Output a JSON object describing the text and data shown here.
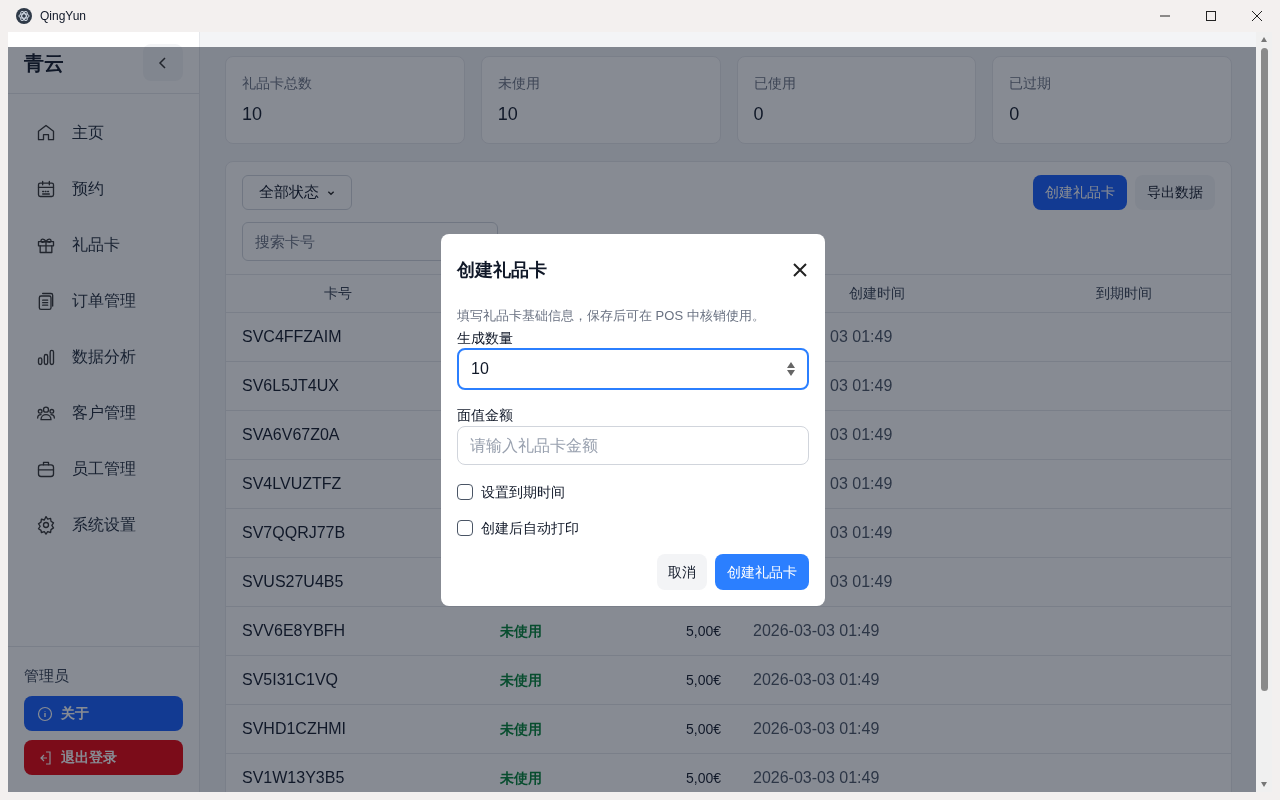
{
  "window": {
    "title": "QingYun"
  },
  "sidebar": {
    "logo": "青云",
    "items": [
      {
        "label": "主页"
      },
      {
        "label": "预约"
      },
      {
        "label": "礼品卡"
      },
      {
        "label": "订单管理"
      },
      {
        "label": "数据分析"
      },
      {
        "label": "客户管理"
      },
      {
        "label": "员工管理"
      },
      {
        "label": "系统设置"
      }
    ],
    "user": "管理员",
    "buttons": [
      {
        "label": "关于",
        "kind": "about"
      },
      {
        "label": "退出登录",
        "kind": "logout"
      }
    ]
  },
  "stats": [
    {
      "label": "礼品卡总数",
      "value": "10"
    },
    {
      "label": "未使用",
      "value": "10"
    },
    {
      "label": "已使用",
      "value": "0"
    },
    {
      "label": "已过期",
      "value": "0"
    }
  ],
  "filters": {
    "status_select": "全部状态",
    "search_placeholder": "搜索卡号"
  },
  "actions": [
    {
      "label": "创建礼品卡",
      "kind": "primary"
    },
    {
      "label": "导出数据",
      "kind": "secondary"
    }
  ],
  "table": {
    "columns": {
      "card_no": "卡号",
      "created": "创建时间",
      "expires": "到期时间"
    },
    "rows": [
      {
        "card_no": "SVC4FFZAIM",
        "created": "03 01:49"
      },
      {
        "card_no": "SV6L5JT4UX",
        "created": "03 01:49"
      },
      {
        "card_no": "SVA6V67Z0A",
        "created": "03 01:49"
      },
      {
        "card_no": "SV4LVUZTFZ",
        "created": "03 01:49"
      },
      {
        "card_no": "SV7QQRJ77B",
        "created": "03 01:49"
      },
      {
        "card_no": "SVUS27U4B5",
        "created": "03 01:49"
      },
      {
        "card_no": "SVV6E8YBFH",
        "status": "未使用",
        "amount": "5,00€",
        "created": "2026-03-03 01:49"
      },
      {
        "card_no": "SV5I31C1VQ",
        "status": "未使用",
        "amount": "5,00€",
        "created": "2026-03-03 01:49"
      },
      {
        "card_no": "SVHD1CZHMI",
        "status": "未使用",
        "amount": "5,00€",
        "created": "2026-03-03 01:49"
      },
      {
        "card_no": "SV1W13Y3B5",
        "status": "未使用",
        "amount": "5,00€",
        "created": "2026-03-03 01:49"
      }
    ]
  },
  "dialog": {
    "title": "创建礼品卡",
    "description": "填写礼品卡基础信息，保存后可在 POS 中核销使用。",
    "fields": [
      {
        "label": "生成数量",
        "value": "10",
        "kind": "number",
        "focused": true
      },
      {
        "label": "面值金额",
        "placeholder": "请输入礼品卡金额",
        "kind": "text",
        "focused": false
      }
    ],
    "checkboxes": [
      {
        "label": "设置到期时间",
        "checked": false
      },
      {
        "label": "创建后自动打印",
        "checked": false
      }
    ],
    "buttons": [
      {
        "label": "取消",
        "kind": "secondary"
      },
      {
        "label": "创建礼品卡",
        "kind": "primary"
      }
    ]
  }
}
